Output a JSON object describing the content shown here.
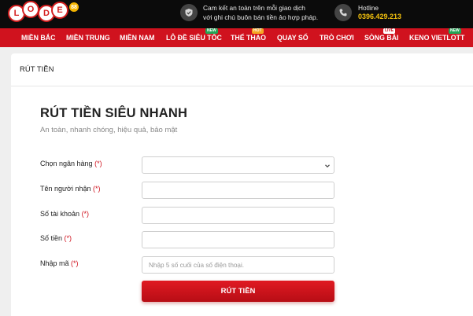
{
  "logo": {
    "letters": [
      "L",
      "O",
      "D",
      "E"
    ],
    "accent": "88"
  },
  "header": {
    "promise_line1": "Cam kết an toàn trên mỗi giao dịch",
    "promise_line2": "với ghi chú buôn bán tiền ảo hợp pháp.",
    "hotline_label": "Hotline",
    "hotline_number": "0396.429.213"
  },
  "nav": {
    "items": [
      {
        "label": "MIỀN BẮC",
        "badge": ""
      },
      {
        "label": "MIỀN TRUNG",
        "badge": ""
      },
      {
        "label": "MIỀN NAM",
        "badge": ""
      },
      {
        "label": "LÔ ĐỀ SIÊU TỐC",
        "badge": "NEW"
      },
      {
        "label": "THỂ THAO",
        "badge": "HOT"
      },
      {
        "label": "QUAY SỐ",
        "badge": ""
      },
      {
        "label": "TRÒ CHƠI",
        "badge": ""
      },
      {
        "label": "SÒNG BÀI",
        "badge": "LIVE"
      },
      {
        "label": "KENO VIETLOTT",
        "badge": "NEW"
      }
    ]
  },
  "tab": {
    "label": "RÚT TIỀN"
  },
  "form": {
    "title": "RÚT TIỀN SIÊU NHANH",
    "subtitle": "An toàn, nhanh chóng, hiệu quả, bảo mật",
    "required_mark": "(*)",
    "bank_label": "Chọn ngân hàng",
    "bank_value": "",
    "recipient_label": "Tên người nhận",
    "recipient_value": "",
    "account_label": "Số tài khoản",
    "account_value": "",
    "amount_label": "Số tiền",
    "amount_value": "",
    "code_label": "Nhập mã",
    "code_value": "",
    "code_placeholder": "Nhập 5 số cuối của số điện thoại.",
    "submit_label": "RÚT TIỀN"
  },
  "colors": {
    "nav_red": "#d0121e",
    "topbar": "#0b0b0b",
    "hotline": "#f4c20d"
  },
  "icons": [
    "shield-check-icon",
    "phone-icon",
    "chevron-down-icon"
  ]
}
